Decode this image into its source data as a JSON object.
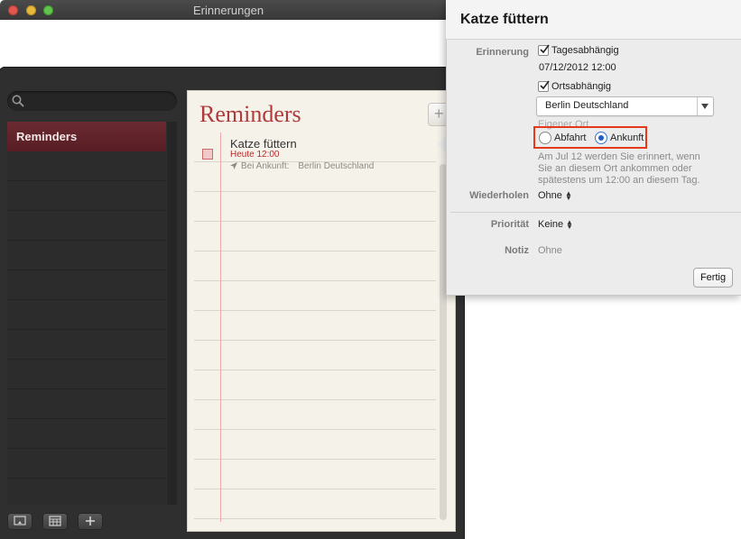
{
  "window": {
    "title": "Erinnerungen"
  },
  "sidebar": {
    "search_placeholder": "",
    "lists": [
      {
        "label": "Reminders",
        "selected": true
      }
    ]
  },
  "paper": {
    "title": "Reminders",
    "add_label": "+",
    "items": [
      {
        "title": "Katze füttern",
        "time": "Heute 12:00",
        "location_prefix": "Bei Ankunft:",
        "location": "Berlin Deutschland"
      }
    ]
  },
  "popover": {
    "title": "Katze füttern",
    "reminder_label": "Erinnerung",
    "day_based_label": "Tagesabhängig",
    "day_based_checked": true,
    "datetime": "07/12/2012  12:00",
    "location_based_label": "Ortsabhängig",
    "location_based_checked": true,
    "location_value": "Berlin Deutschland",
    "custom_location_label": "Eigener Ort",
    "departure_label": "Abfahrt",
    "arrival_label": "Ankunft",
    "selected_trigger": "Ankunft",
    "info_lines": [
      "Am Jul 12 werden Sie erinnert, wenn",
      "Sie an diesem Ort ankommen oder",
      "spätestens um 12:00  an diesem Tag."
    ],
    "repeat_label": "Wiederholen",
    "repeat_value": "Ohne",
    "priority_label": "Priorität",
    "priority_value": "Keine",
    "note_label": "Notiz",
    "note_value": "Ohne",
    "done_label": "Fertig"
  },
  "colors": {
    "accent_red": "#b0393c",
    "selected_list": "#6b2a31",
    "highlight_box": "#e5391c",
    "radio_selected": "#1f5fbf"
  }
}
